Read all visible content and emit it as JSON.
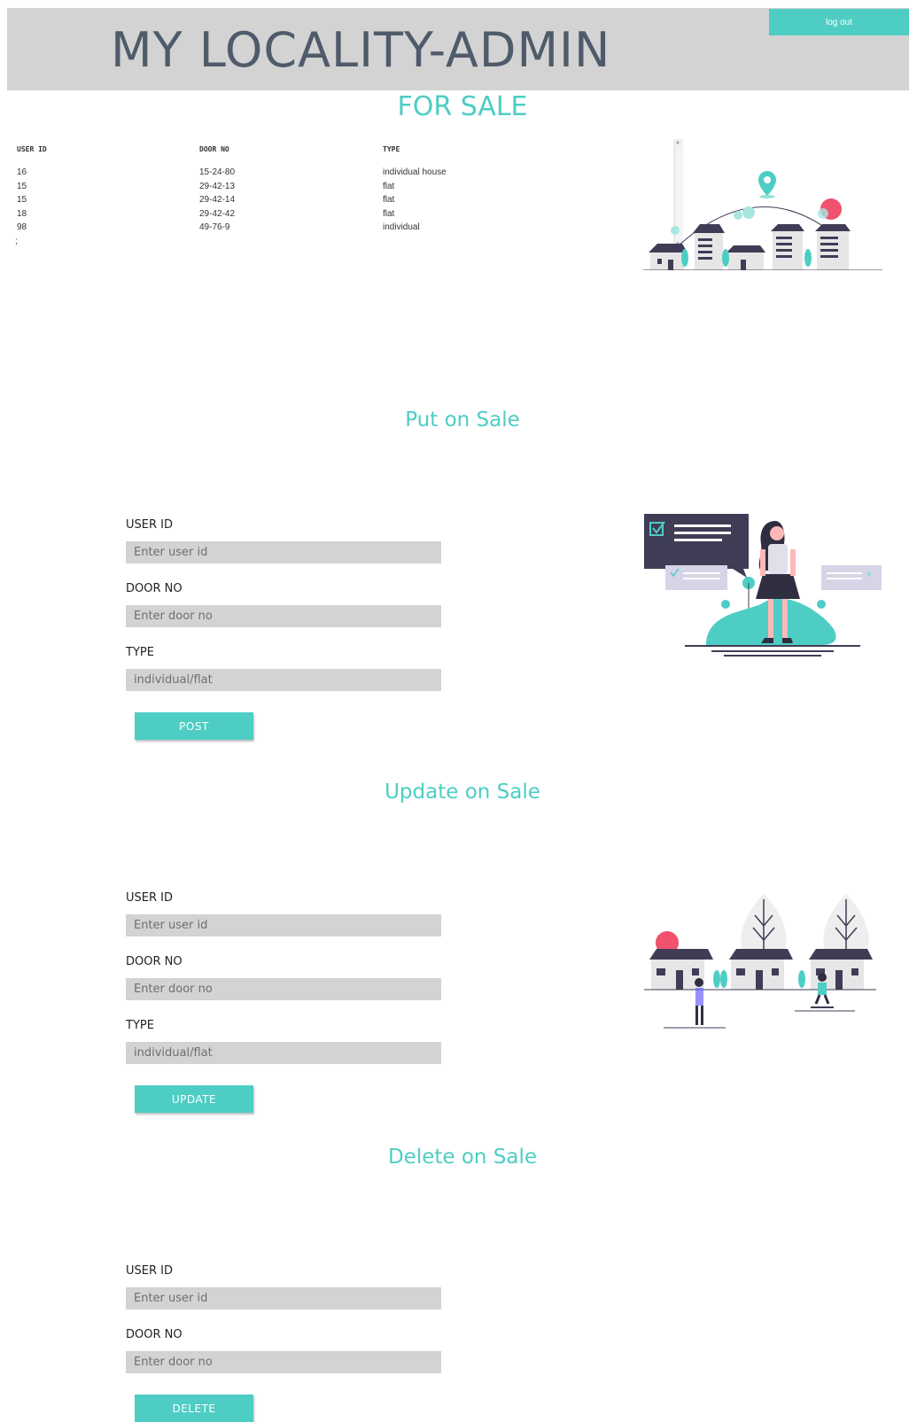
{
  "header": {
    "title": "MY LOCALITY-ADMIN",
    "logout_label": "log out"
  },
  "for_sale": {
    "title": "FOR SALE",
    "columns": [
      "USER ID",
      "DOOR NO",
      "TYPE"
    ],
    "rows": [
      [
        "16",
        "15-24-80",
        "individual house"
      ],
      [
        "15",
        "29-42-13",
        "flat"
      ],
      [
        "15",
        "29-42-14",
        "flat"
      ],
      [
        "18",
        "29-42-42",
        "flat"
      ],
      [
        "98",
        "49-76-9",
        "individual"
      ]
    ],
    "trailing_text": ";"
  },
  "put_on_sale": {
    "title": "Put on Sale",
    "user_id_label": "USER ID",
    "user_id_placeholder": "Enter user id",
    "door_no_label": "DOOR NO",
    "door_no_placeholder": "Enter door no",
    "type_label": "TYPE",
    "type_placeholder": "individual/flat",
    "button_label": "POST"
  },
  "update_on_sale": {
    "title": "Update on Sale",
    "user_id_label": "USER ID",
    "user_id_placeholder": "Enter user id",
    "door_no_label": "DOOR NO",
    "door_no_placeholder": "Enter door no",
    "type_label": "TYPE",
    "type_placeholder": "individual/flat",
    "button_label": "UPDATE"
  },
  "delete_on_sale": {
    "title": "Delete on Sale",
    "user_id_label": "USER ID",
    "user_id_placeholder": "Enter user id",
    "door_no_label": "DOOR NO",
    "door_no_placeholder": "Enter door no",
    "button_label": "DELETE"
  },
  "colors": {
    "accent": "#4ecdc4",
    "header_bg": "#d3d3d3",
    "title_text": "#4f5b6b",
    "input_bg": "#d3d3d3",
    "illustration_dark": "#3f3d56",
    "illustration_pink": "#f0516d"
  },
  "icons": {
    "illustrations": [
      "city-map-pin-illustration",
      "woman-with-checklist-illustration",
      "houses-with-people-illustration"
    ],
    "scrollbar_arrows": [
      "scroll-up-icon",
      "scroll-down-icon"
    ]
  }
}
